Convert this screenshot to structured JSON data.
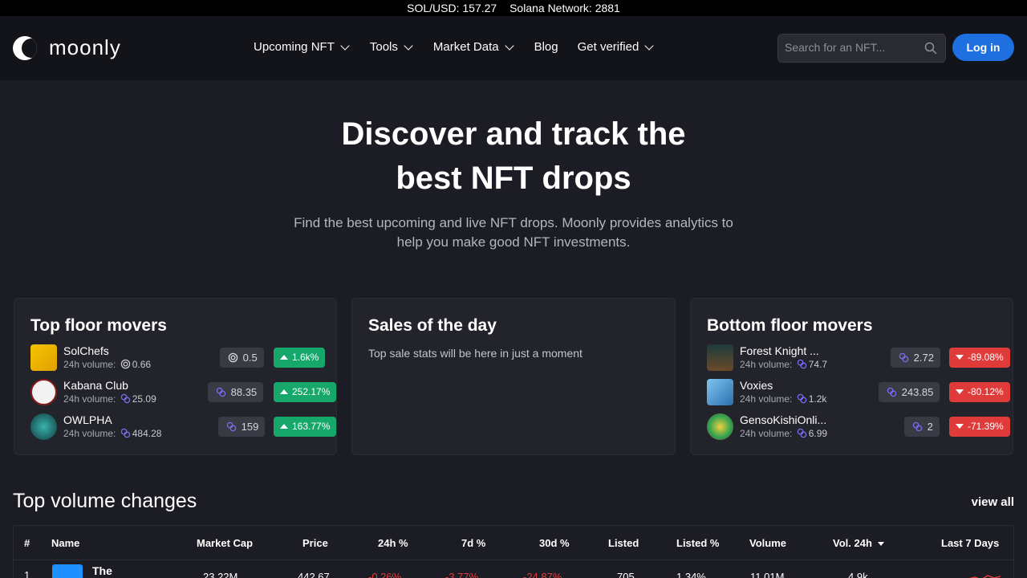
{
  "ticker": {
    "price": "SOL/USD: 157.27",
    "network": "Solana Network: 2881"
  },
  "nav": {
    "brand": "moonly",
    "menu": [
      {
        "label": "Upcoming NFT",
        "dropdown": true
      },
      {
        "label": "Tools",
        "dropdown": true
      },
      {
        "label": "Market Data",
        "dropdown": true
      },
      {
        "label": "Blog",
        "dropdown": false
      },
      {
        "label": "Get verified",
        "dropdown": true
      }
    ],
    "search_placeholder": "Search for an NFT...",
    "login": "Log in"
  },
  "hero": {
    "title_line1": "Discover and track the",
    "title_line2": "best NFT drops",
    "subtitle_line1": "Find the best upcoming and live NFT drops. Moonly provides analytics to",
    "subtitle_line2": "help you make good NFT investments."
  },
  "top_movers": {
    "title": "Top floor movers",
    "vol_label": "24h volume:",
    "items": [
      {
        "name": "SolChefs",
        "volume": "0.66",
        "floor": "0.5",
        "change": "1.6k%"
      },
      {
        "name": "Kabana Club",
        "volume": "25.09",
        "floor": "88.35",
        "change": "252.17%"
      },
      {
        "name": "OWLPHA",
        "volume": "484.28",
        "floor": "159",
        "change": "163.77%"
      }
    ]
  },
  "sales": {
    "title": "Sales of the day",
    "note": "Top sale stats will be here in just a moment"
  },
  "bottom_movers": {
    "title": "Bottom floor movers",
    "vol_label": "24h volume:",
    "items": [
      {
        "name": "Forest Knight ...",
        "volume": "74.7",
        "floor": "2.72",
        "change": "-89.08%"
      },
      {
        "name": "Voxies",
        "volume": "1.2k",
        "floor": "243.85",
        "change": "-80.12%"
      },
      {
        "name": "GensoKishiOnli...",
        "volume": "6.99",
        "floor": "2",
        "change": "-71.39%"
      }
    ]
  },
  "volume_section": {
    "title": "Top volume changes",
    "view_all": "view all",
    "columns": [
      "#",
      "Name",
      "Market Cap",
      "Price",
      "24h %",
      "7d %",
      "30d %",
      "Listed",
      "Listed %",
      "Volume",
      "Vol. 24h",
      "Last 7 Days"
    ],
    "sort_column": "Vol. 24h",
    "first_row": {
      "rank": "1",
      "name": "The",
      "market_cap": "23.22M",
      "price": "442.67",
      "change_24h": "-0.26%",
      "change_7d": "-3.77%",
      "change_30d": "-24.87%",
      "listed": "705",
      "listed_pct": "1.34%",
      "volume": "11.01M",
      "vol_24h": "4.9k"
    }
  },
  "colors": {
    "accent": "#1e6fe0",
    "up": "#16a86a",
    "down": "#e03b3b",
    "bg": "#1c1c24",
    "nav": "#13131a"
  }
}
